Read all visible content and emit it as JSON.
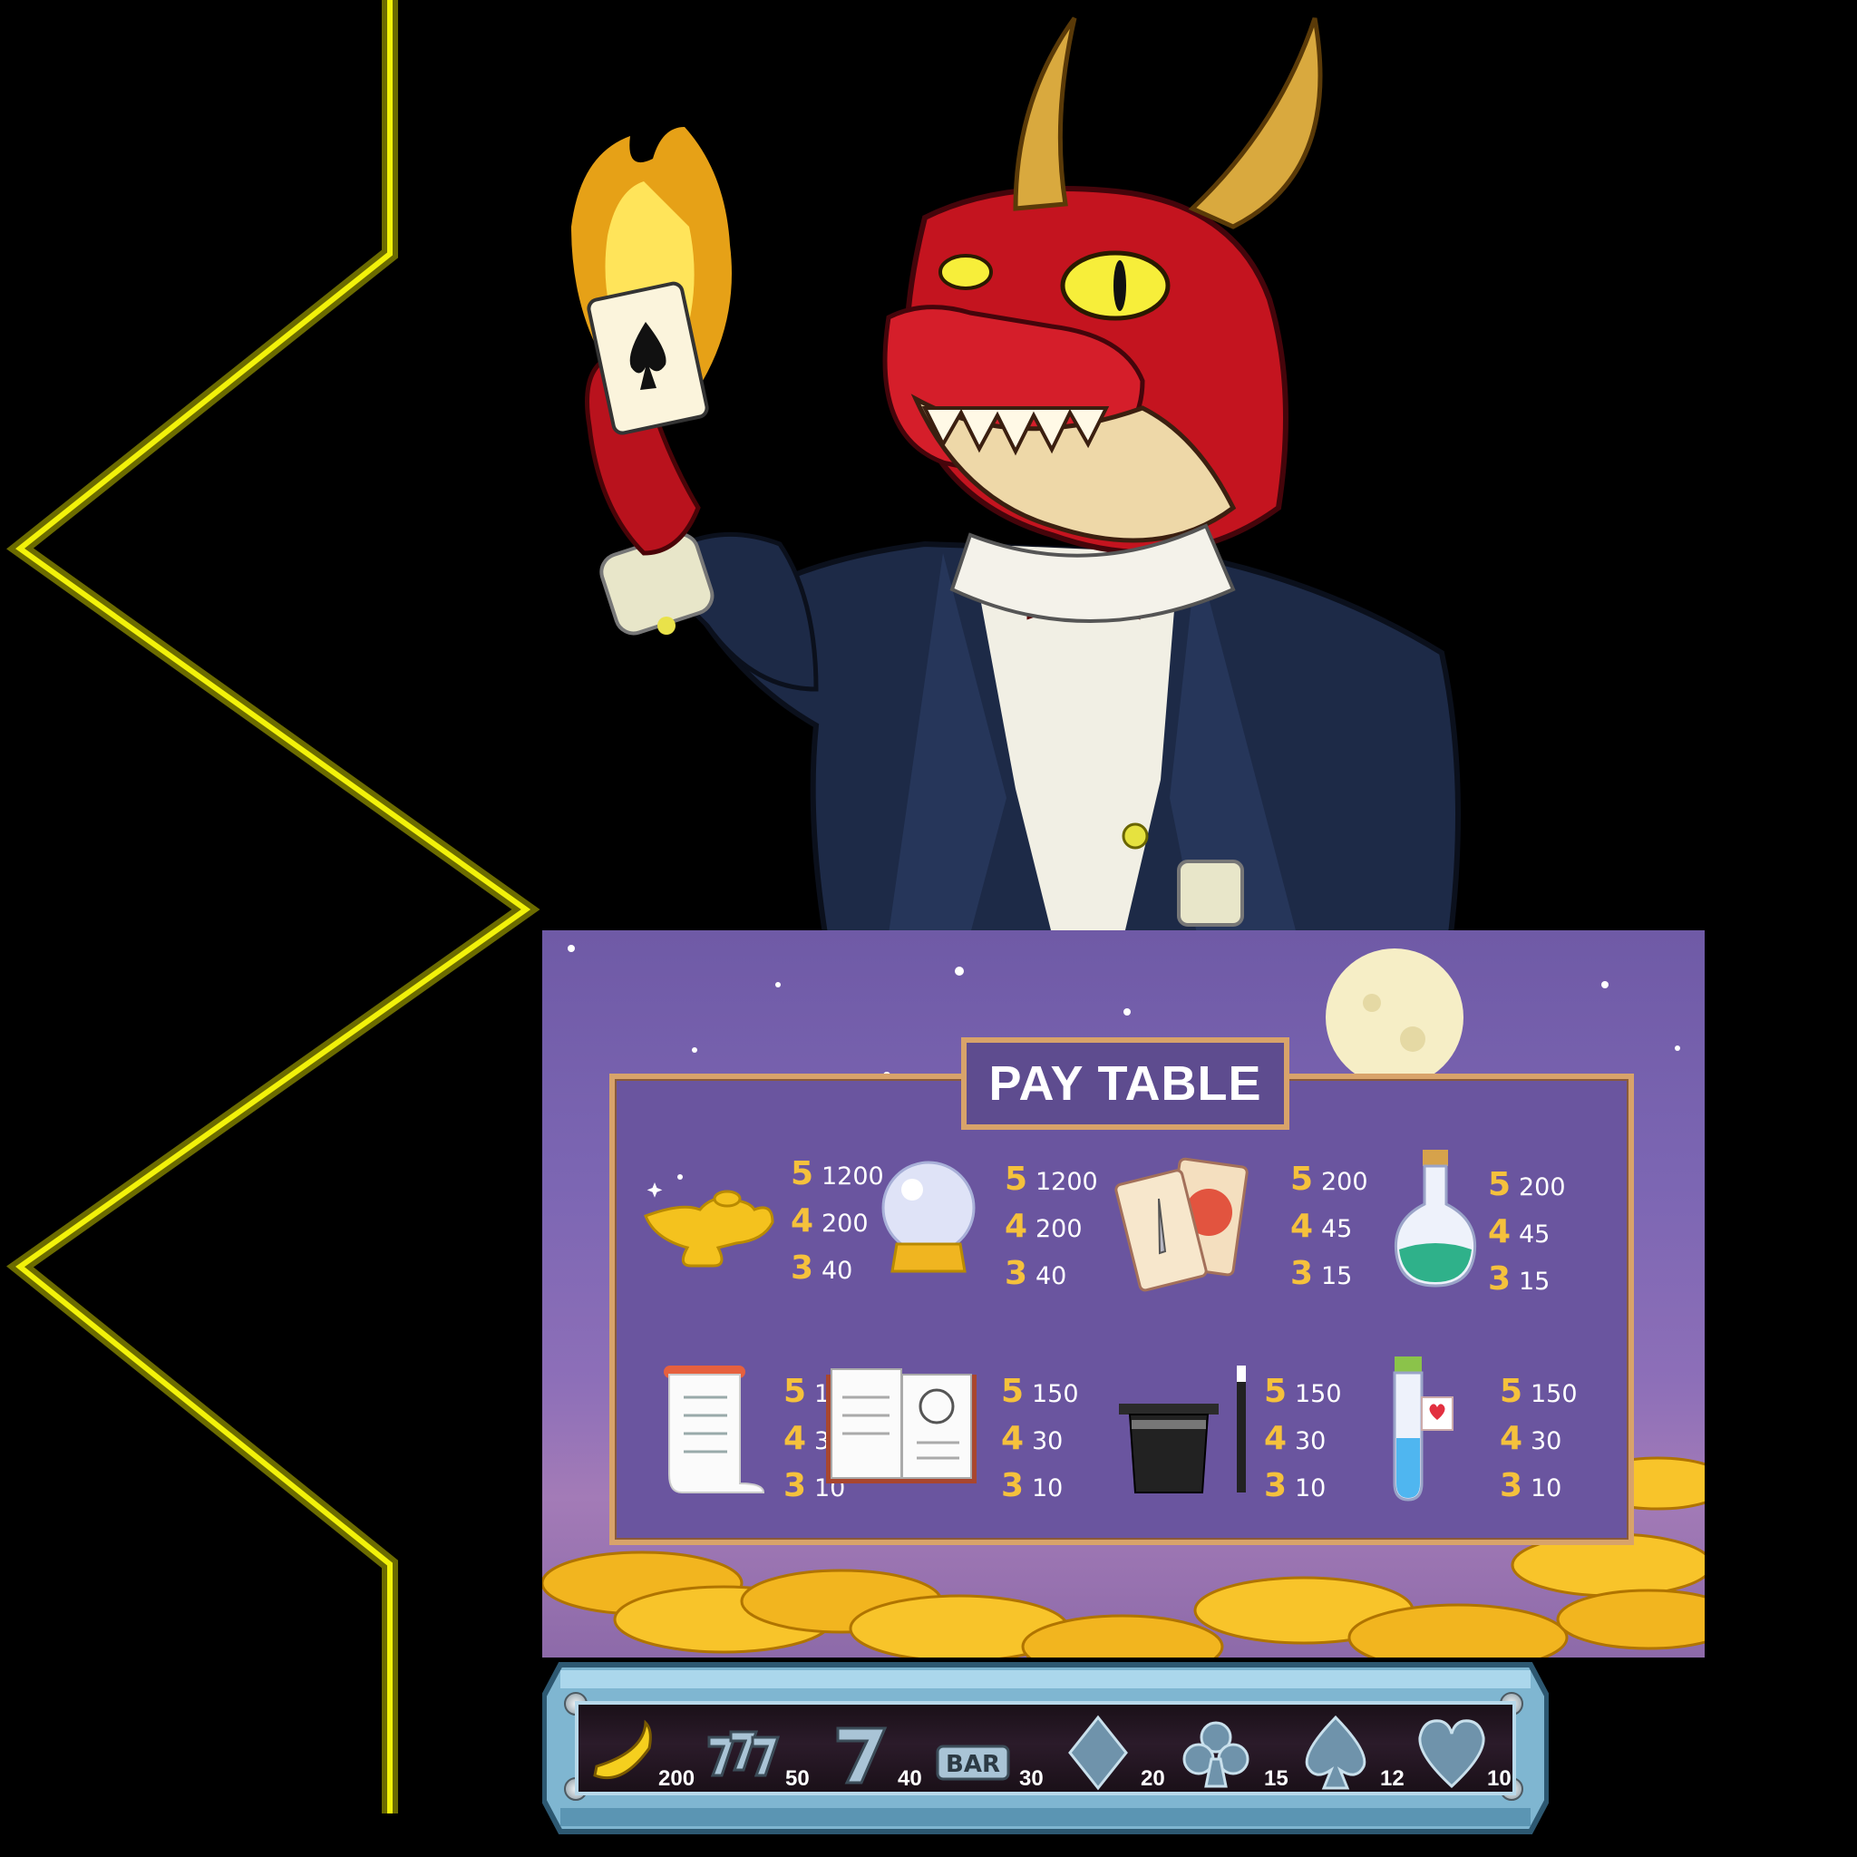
{
  "paytable": {
    "title": "PAY TABLE",
    "symbols": [
      {
        "id": "magic-lamp",
        "icon": "magic-lamp-icon",
        "pays": [
          {
            "count": "5",
            "value": "1200"
          },
          {
            "count": "4",
            "value": "200"
          },
          {
            "count": "3",
            "value": "40"
          }
        ]
      },
      {
        "id": "crystal-ball",
        "icon": "crystal-ball-icon",
        "pays": [
          {
            "count": "5",
            "value": "1200"
          },
          {
            "count": "4",
            "value": "200"
          },
          {
            "count": "3",
            "value": "40"
          }
        ]
      },
      {
        "id": "tarot-cards",
        "icon": "tarot-cards-icon",
        "pays": [
          {
            "count": "5",
            "value": "200"
          },
          {
            "count": "4",
            "value": "45"
          },
          {
            "count": "3",
            "value": "15"
          }
        ]
      },
      {
        "id": "green-potion",
        "icon": "green-potion-icon",
        "pays": [
          {
            "count": "5",
            "value": "200"
          },
          {
            "count": "4",
            "value": "45"
          },
          {
            "count": "3",
            "value": "15"
          }
        ]
      },
      {
        "id": "scroll",
        "icon": "scroll-icon",
        "pays": [
          {
            "count": "5",
            "value": "150"
          },
          {
            "count": "4",
            "value": "30"
          },
          {
            "count": "3",
            "value": "10"
          }
        ]
      },
      {
        "id": "spell-book",
        "icon": "spell-book-icon",
        "pays": [
          {
            "count": "5",
            "value": "150"
          },
          {
            "count": "4",
            "value": "30"
          },
          {
            "count": "3",
            "value": "10"
          }
        ]
      },
      {
        "id": "magic-hat",
        "icon": "magic-hat-wand-icon",
        "pays": [
          {
            "count": "5",
            "value": "150"
          },
          {
            "count": "4",
            "value": "30"
          },
          {
            "count": "3",
            "value": "10"
          }
        ]
      },
      {
        "id": "love-potion",
        "icon": "love-potion-icon",
        "pays": [
          {
            "count": "5",
            "value": "150"
          },
          {
            "count": "4",
            "value": "30"
          },
          {
            "count": "3",
            "value": "10"
          }
        ]
      }
    ]
  },
  "strip": {
    "items": [
      {
        "icon": "banana-icon",
        "value": "200"
      },
      {
        "icon": "triple-seven-icon",
        "value": "50"
      },
      {
        "icon": "seven-icon",
        "value": "40"
      },
      {
        "icon": "bar-icon",
        "value": "30"
      },
      {
        "icon": "diamond-icon",
        "value": "20"
      },
      {
        "icon": "club-icon",
        "value": "15"
      },
      {
        "icon": "spade-icon",
        "value": "12"
      },
      {
        "icon": "heart-icon",
        "value": "10"
      }
    ]
  },
  "colors": {
    "neon_yellow": "#f2f20a",
    "gold": "#f5c13c",
    "frame_copper": "#d8a36a",
    "panel_purple": "#6a559f",
    "strip_blue": "#7fb6d1"
  }
}
